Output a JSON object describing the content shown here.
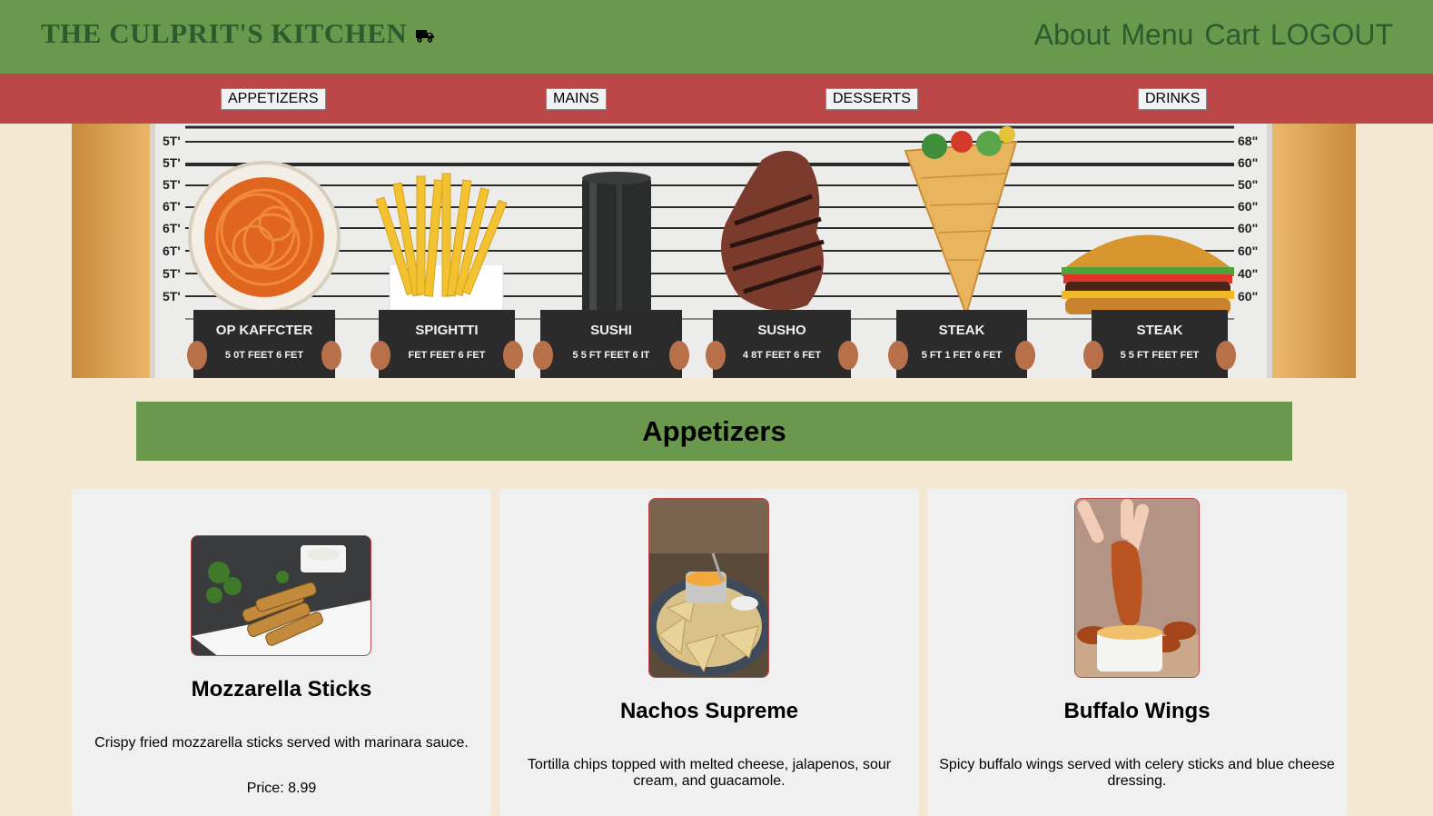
{
  "header": {
    "brand": "THE CULPRIT'S KITCHEN",
    "brand_icon": "truck-icon",
    "nav": [
      "About",
      "Menu",
      "Cart",
      "LOGOUT"
    ]
  },
  "categories": [
    "APPETIZERS",
    "MAINS",
    "DESSERTS",
    "DRINKS"
  ],
  "hero": {
    "height_marks_left": [
      "5T'",
      "5T'",
      "5T'",
      "6T'",
      "6T'",
      "6T'",
      "5T'",
      "5T'"
    ],
    "height_marks_right": [
      "68\"",
      "60\"",
      "50\"",
      "60\"",
      "60\"",
      "60\"",
      "40\"",
      "60\""
    ],
    "suspects": [
      {
        "food": "spaghetti",
        "sign_title": "OP KAFFCTER",
        "sign_sub": "5 0T FEET 6 FET"
      },
      {
        "food": "fries",
        "sign_title": "SPIGHTTI",
        "sign_sub": "FET FEET 6 FET"
      },
      {
        "food": "sushi-roll",
        "sign_title": "SUSHI",
        "sign_sub": "5 5 FT FEET 6 IT"
      },
      {
        "food": "steak",
        "sign_title": "SUSHO",
        "sign_sub": "4 8T FEET 6 FET"
      },
      {
        "food": "burrito",
        "sign_title": "STEAK",
        "sign_sub": "5 FT 1 FET 6 FET"
      },
      {
        "food": "burger",
        "sign_title": "STEAK",
        "sign_sub": "5 5 FT FEET FET"
      }
    ]
  },
  "section": {
    "title": "Appetizers"
  },
  "items": [
    {
      "name": "Mozzarella Sticks",
      "description": "Crispy fried mozzarella sticks served with marinara sauce.",
      "price": "Price: 8.99",
      "image": "mozzarella-sticks-photo"
    },
    {
      "name": "Nachos Supreme",
      "description": "Tortilla chips topped with melted cheese, jalapenos, sour cream, and guacamole.",
      "price": "",
      "image": "nachos-photo"
    },
    {
      "name": "Buffalo Wings",
      "description": "Spicy buffalo wings served with celery sticks and blue cheese dressing.",
      "price": "",
      "image": "buffalo-wings-photo"
    }
  ],
  "colors": {
    "header_green": "#6a994d",
    "brand_text": "#2f5a2e",
    "category_red": "#bc4749",
    "page_bg": "#f5e8d2",
    "card_bg": "#f0f0f0"
  }
}
